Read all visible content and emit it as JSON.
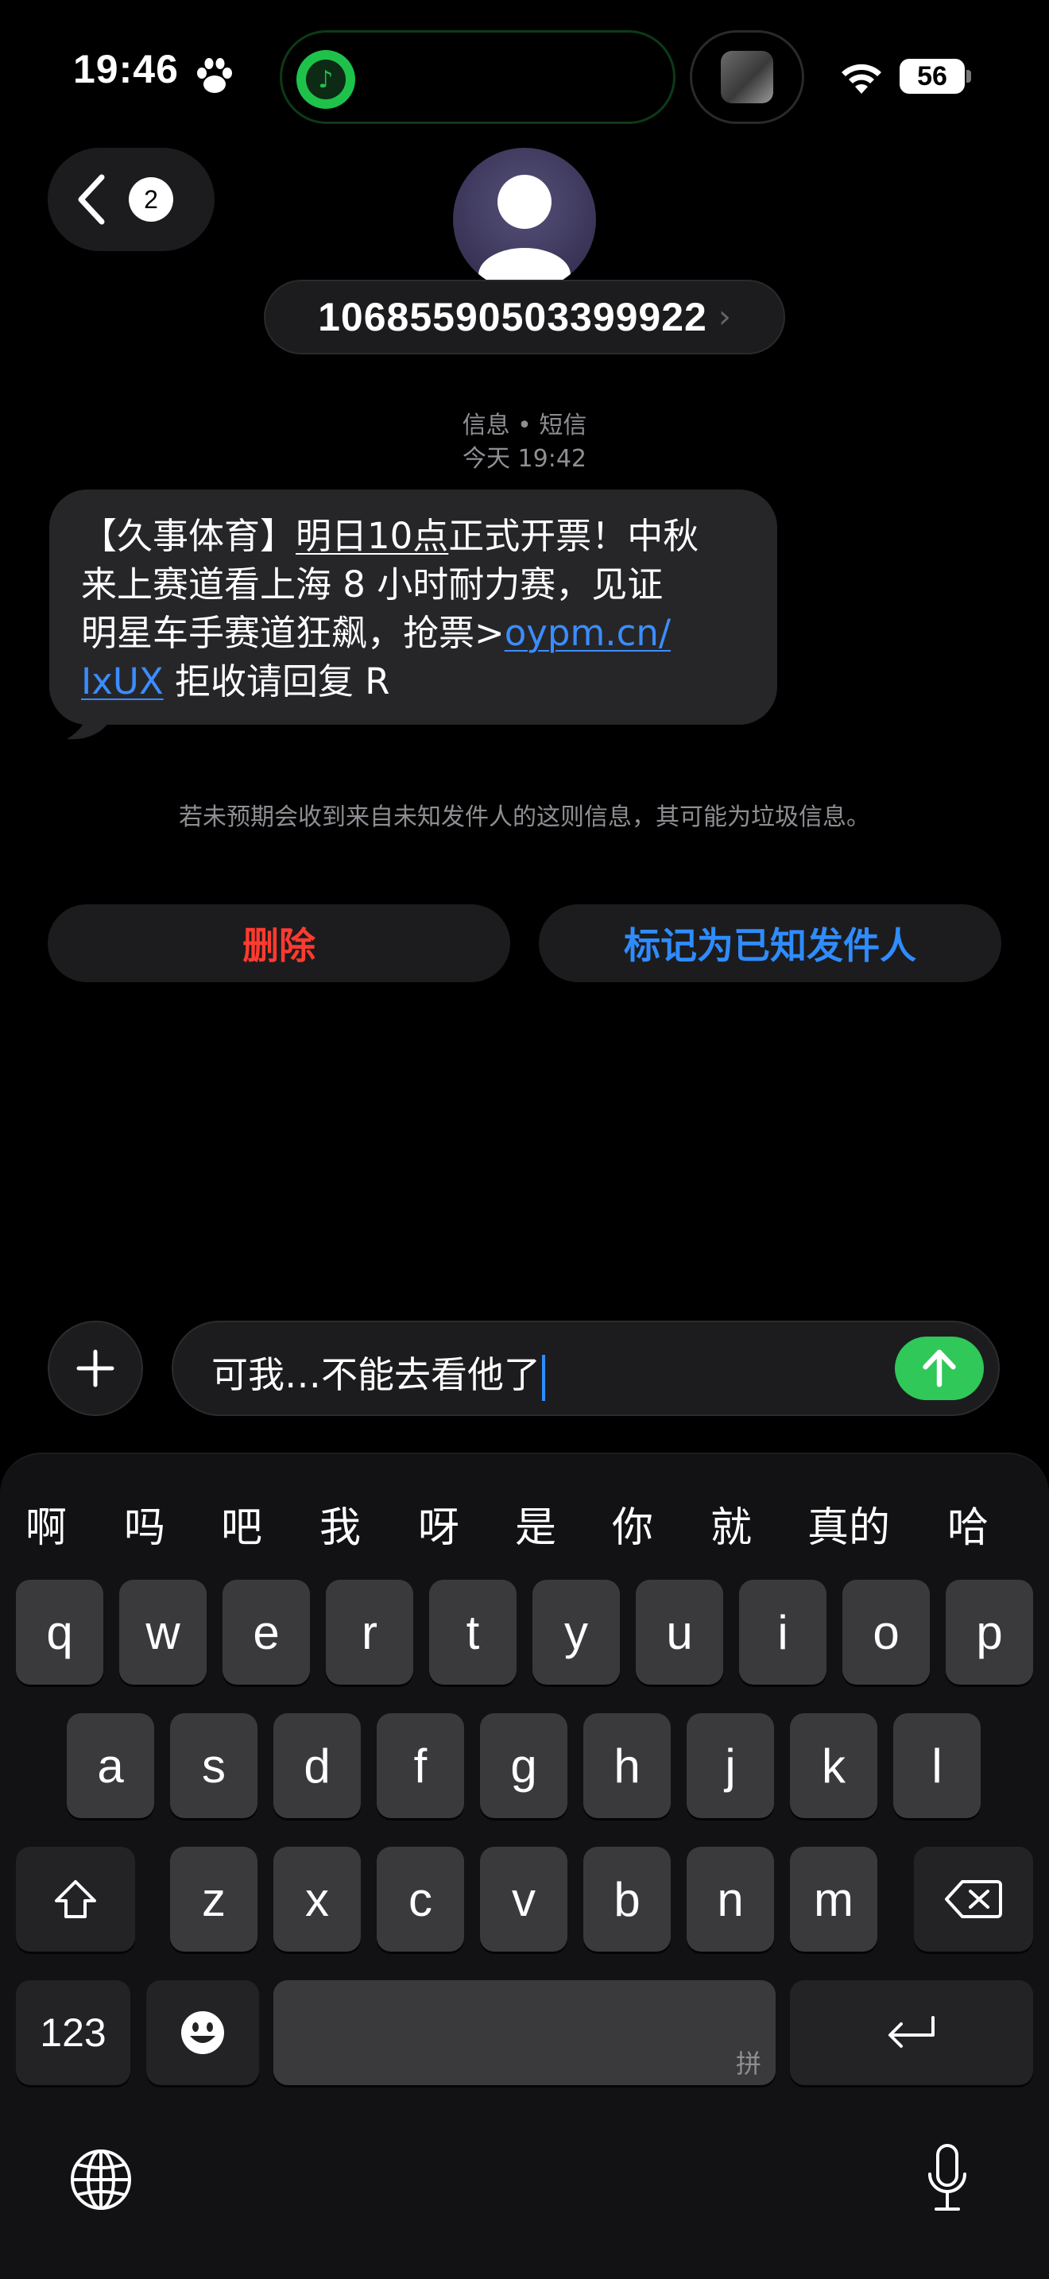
{
  "status_bar": {
    "time": "19:46",
    "battery": "56",
    "icons": [
      "paw-icon",
      "music-app-icon",
      "media-thumbnail",
      "wifi-icon",
      "battery-icon"
    ]
  },
  "header": {
    "back_badge": "2",
    "contact_number": "10685590503399922",
    "chevron": "›"
  },
  "message_meta": {
    "channel": "信息 • 短信",
    "timestamp": "今天 19:42"
  },
  "message": {
    "line1_prefix": "【久事体育】",
    "line1_underlined": "明日10点",
    "line1_suffix": "正式开票！中秋",
    "line2": "来上赛道看上海 8 小时耐力赛，见证",
    "line3_text": "明星车手赛道狂飙，抢票>",
    "link_part1": "oypm.cn/",
    "link_part2": "IxUX",
    "line4_suffix": " 拒收请回复 R"
  },
  "warning": "若未预期会收到来自未知发件人的这则信息，其可能为垃圾信息。",
  "actions": {
    "delete": "删除",
    "mark_known": "标记为已知发件人"
  },
  "composer": {
    "text": "可我…不能去看他了"
  },
  "keyboard": {
    "candidates": [
      "啊",
      "吗",
      "吧",
      "我",
      "呀",
      "是",
      "你",
      "就",
      "真的",
      "哈"
    ],
    "row1": [
      "q",
      "w",
      "e",
      "r",
      "t",
      "y",
      "u",
      "i",
      "o",
      "p"
    ],
    "row2": [
      "a",
      "s",
      "d",
      "f",
      "g",
      "h",
      "j",
      "k",
      "l"
    ],
    "row3": [
      "z",
      "x",
      "c",
      "v",
      "b",
      "n",
      "m"
    ],
    "numbers_key": "123",
    "space_hint": "拼",
    "special_icons": [
      "shift-icon",
      "delete-icon",
      "emoji-icon",
      "return-icon",
      "globe-icon",
      "microphone-icon"
    ]
  },
  "colors": {
    "accent_blue": "#2f8cff",
    "destructive_red": "#ff3b30",
    "send_green": "#30c859",
    "bubble_gray": "#262629"
  }
}
